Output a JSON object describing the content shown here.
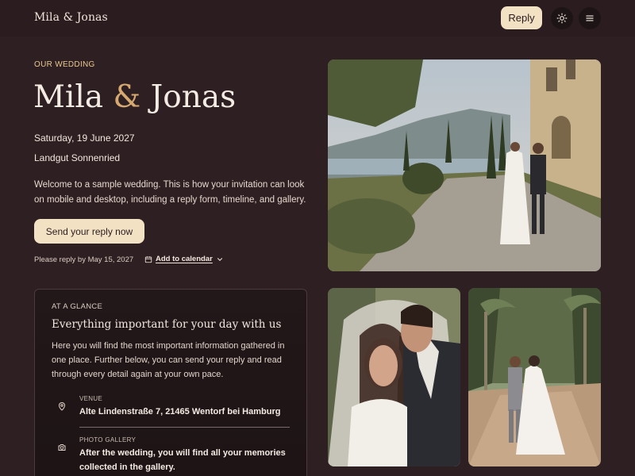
{
  "header": {
    "brand": "Mila & Jonas",
    "reply_label": "Reply",
    "theme_icon": "sun-icon",
    "menu_icon": "hamburger-menu-icon"
  },
  "hero": {
    "eyebrow": "OUR WEDDING",
    "title_part1": "Mila",
    "title_amp": "&",
    "title_part2": "Jonas",
    "date": "Saturday, 19 June 2027",
    "venue": "Landgut Sonnenried",
    "intro": "Welcome to a sample wedding. This is how your invitation can look on mobile and desktop, including a reply form, timeline, and gallery.",
    "cta_label": "Send your reply now",
    "deadline": "Please reply by May 15, 2027",
    "add_calendar_label": "Add to calendar"
  },
  "glance": {
    "eyebrow": "AT A GLANCE",
    "heading": "Everything important for your day with us",
    "body": "Here you will find the most important information gathered in one place. Further below, you can send your reply and read through every detail again at your own pace.",
    "items": [
      {
        "icon": "map-pin-icon",
        "label": "VENUE",
        "value": "Alte Lindenstraße 7, 21465 Wentorf bei Hamburg"
      },
      {
        "icon": "camera-icon",
        "label": "PHOTO GALLERY",
        "value": "After the wedding, you will find all your memories collected in the gallery."
      }
    ]
  },
  "colors": {
    "background": "#2e1f22",
    "accent": "#f3e1c4",
    "accent_text": "#e9c78f",
    "ampersand": "#d6a970"
  }
}
